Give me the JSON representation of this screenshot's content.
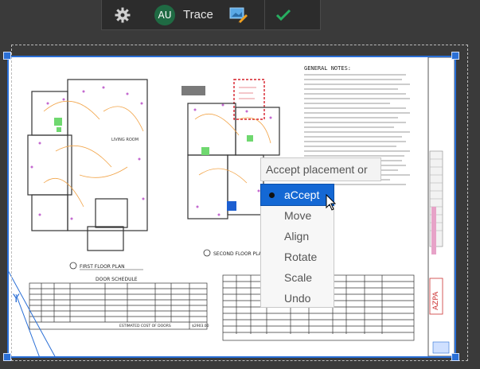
{
  "toolbar": {
    "settings_icon": "gear-icon",
    "user_initials": "AU",
    "trace_label": "Trace",
    "edit_icon": "image-edit-icon",
    "confirm_icon": "checkmark-icon",
    "colors": {
      "bar": "#2c2c2c",
      "avatar": "#1f6a43",
      "check": "#27ae60"
    }
  },
  "selection": {
    "color": "#2a6fd6"
  },
  "prompt": {
    "text": "Accept placement or"
  },
  "context_menu": {
    "items": [
      {
        "label": "aCcept",
        "active": true
      },
      {
        "label": "Move",
        "active": false
      },
      {
        "label": "Align",
        "active": false
      },
      {
        "label": "Rotate",
        "active": false
      },
      {
        "label": "Scale",
        "active": false
      },
      {
        "label": "Undo",
        "active": false
      }
    ],
    "active_color": "#1468d4"
  },
  "drawing": {
    "first_floor_title": "FIRST FLOOR PLAN",
    "second_floor_title": "SECOND FLOOR PLAN",
    "door_schedule_title": "DOOR SCHEDULE",
    "notes_title": "GENERAL NOTES:",
    "door_schedule_total": "ESTIMATED COST OF DOORS",
    "door_schedule_total_value": "$2903.00",
    "living_room_label": "LIVING ROOM"
  }
}
